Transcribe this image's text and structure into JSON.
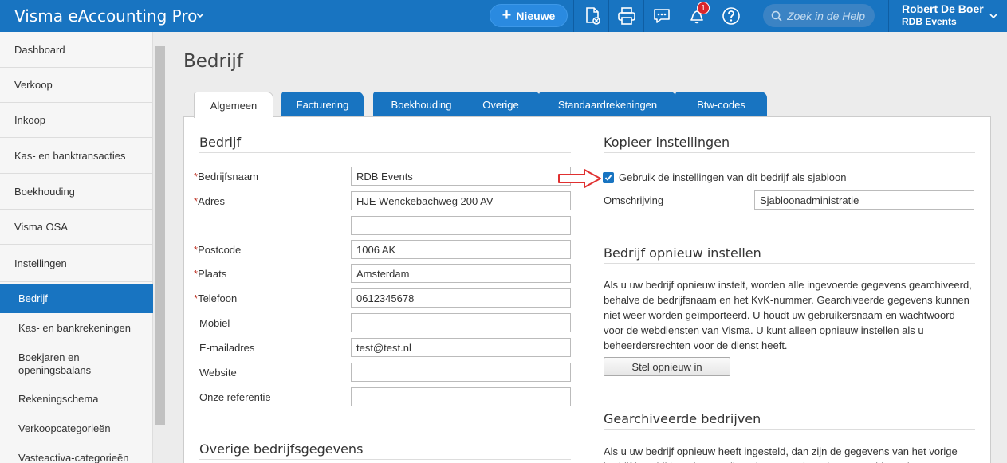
{
  "app": {
    "title": "Visma eAccounting Pro"
  },
  "header": {
    "new_button": "Nieuwe",
    "notification_count": "1",
    "search_placeholder": "Zoek in de Help",
    "user_name": "Robert De Boer",
    "user_org": "RDB Events"
  },
  "sidebar": {
    "items": [
      "Dashboard",
      "Verkoop",
      "Inkoop",
      "Kas- en banktransacties",
      "Boekhouding",
      "Visma OSA",
      "Instellingen"
    ],
    "subitems": [
      "Bedrijf",
      "Kas- en bankrekeningen",
      "Boekjaren en openingsbalans",
      "Rekeningschema",
      "Verkoopcategorieën",
      "Vasteactiva-categorieën"
    ],
    "active": "Bedrijf"
  },
  "page": {
    "title": "Bedrijf"
  },
  "tabs": [
    "Algemeen",
    "Facturering",
    "Boekhouding",
    "Overige",
    "Standaardrekeningen",
    "Btw-codes"
  ],
  "company": {
    "section_title": "Bedrijf",
    "fields": {
      "name": {
        "label": "Bedrijfsnaam",
        "value": "RDB Events"
      },
      "address": {
        "label": "Adres",
        "value": "HJE Wenckebachweg 200 AV"
      },
      "address2": {
        "value": ""
      },
      "postcode": {
        "label": "Postcode",
        "value": "1006 AK"
      },
      "city": {
        "label": "Plaats",
        "value": "Amsterdam"
      },
      "phone": {
        "label": "Telefoon",
        "value": "0612345678"
      },
      "mobile": {
        "label": "Mobiel",
        "value": ""
      },
      "email": {
        "label": "E-mailadres",
        "value": "test@test.nl"
      },
      "website": {
        "label": "Website",
        "value": ""
      },
      "reference": {
        "label": "Onze referentie",
        "value": ""
      }
    },
    "other_section_title": "Overige bedrijfsgegevens"
  },
  "copy_settings": {
    "section_title": "Kopieer instellingen",
    "checkbox_label": "Gebruik de instellingen van dit bedrijf als sjabloon",
    "checked": true,
    "description_label": "Omschrijving",
    "description_value": "Sjabloonadministratie"
  },
  "reset": {
    "section_title": "Bedrijf opnieuw instellen",
    "text": "Als u uw bedrijf opnieuw instelt, worden alle ingevoerde gegevens gearchiveerd, behalve de bedrijfsnaam en het KvK-nummer. Gearchiveerde gegevens kunnen niet weer worden geïmporteerd. U houdt uw gebruikersnaam en wachtwoord voor de webdiensten van Visma. U kunt alleen opnieuw instellen als u beheerdersrechten voor de dienst heeft.",
    "button": "Stel opnieuw in"
  },
  "archived": {
    "section_title": "Gearchiveerde bedrijven",
    "text": "Als u uw bedrijf opnieuw heeft ingesteld, dan zijn de gegevens van het vorige bedrijf beschikbaar in een alleen-lezen versie. U kunt gearchiveerde"
  },
  "colors": {
    "brand": "#1874c1",
    "required": "#c0392b",
    "arrow": "#e03030"
  }
}
